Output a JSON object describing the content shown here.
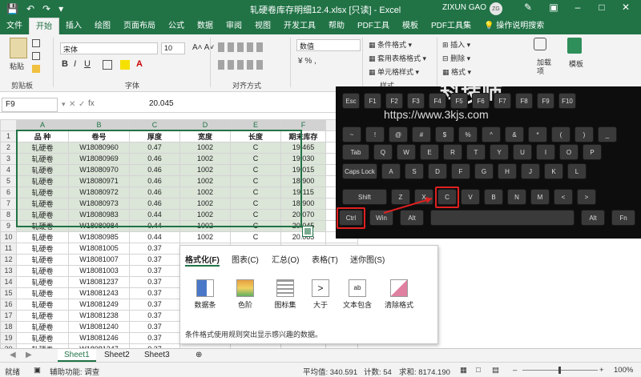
{
  "titlebar": {
    "title": "轧硬卷库存明细12.4.xlsx  [只读]  -  Excel",
    "user": "ZIXUN GAO",
    "avatar": "ZG",
    "qa_icons": [
      "save-icon",
      "undo-icon",
      "redo-icon",
      "customize-icon"
    ]
  },
  "menu": {
    "tabs": [
      "文件",
      "开始",
      "插入",
      "绘图",
      "页面布局",
      "公式",
      "数据",
      "审阅",
      "视图",
      "开发工具",
      "帮助",
      "PDF工具",
      "模板",
      "PDF工具集"
    ],
    "active": "开始",
    "tell_me": "操作说明搜索"
  },
  "ribbon": {
    "paste": "粘贴",
    "clipboard": "剪贴板",
    "font_name": "宋体",
    "font_size": "10",
    "font_group": "字体",
    "align_group": "对齐方式",
    "number_format": "数值",
    "cond_format": "条件格式",
    "table_format": "套用表格格式",
    "cell_styles": "单元格样式",
    "styles_group": "样式",
    "insert": "插入",
    "delete": "删除",
    "format": "格式",
    "addin": "加载项",
    "template": "模板"
  },
  "formula": {
    "cell_ref": "F9",
    "fx": "fx",
    "value": "20.045"
  },
  "sheet": {
    "columns": [
      "A",
      "B",
      "C",
      "D",
      "E",
      "F",
      "G"
    ],
    "rows": [
      [
        "1",
        "品  种",
        "卷号",
        "厚度",
        "宽度",
        "长度",
        "期末库存"
      ],
      [
        "2",
        "轧硬卷",
        "W18080960",
        "0.47",
        "1002",
        "C",
        "19.465"
      ],
      [
        "3",
        "轧硬卷",
        "W18080969",
        "0.46",
        "1002",
        "C",
        "19.030"
      ],
      [
        "4",
        "轧硬卷",
        "W18080970",
        "0.46",
        "1002",
        "C",
        "19.015"
      ],
      [
        "5",
        "轧硬卷",
        "W18080971",
        "0.46",
        "1002",
        "C",
        "18.900"
      ],
      [
        "6",
        "轧硬卷",
        "W18080972",
        "0.46",
        "1002",
        "C",
        "19.115"
      ],
      [
        "7",
        "轧硬卷",
        "W18080973",
        "0.46",
        "1002",
        "C",
        "18.900"
      ],
      [
        "8",
        "轧硬卷",
        "W18080983",
        "0.44",
        "1002",
        "C",
        "20.070"
      ],
      [
        "9",
        "轧硬卷",
        "W18080984",
        "0.44",
        "1002",
        "C",
        "20.045"
      ],
      [
        "10",
        "轧硬卷",
        "W18080985",
        "0.44",
        "1002",
        "C",
        "20.085"
      ],
      [
        "11",
        "轧硬卷",
        "W18081005",
        "0.37",
        "1002",
        "C",
        "17.630"
      ],
      [
        "12",
        "轧硬卷",
        "W18081007",
        "0.37",
        "",
        "",
        ""
      ],
      [
        "13",
        "轧硬卷",
        "W18081003",
        "0.37",
        "",
        "",
        ""
      ],
      [
        "14",
        "轧硬卷",
        "W18081237",
        "0.37",
        "",
        "",
        ""
      ],
      [
        "15",
        "轧硬卷",
        "W18081243",
        "0.37",
        "",
        "",
        ""
      ],
      [
        "16",
        "轧硬卷",
        "W18081249",
        "0.37",
        "",
        "",
        ""
      ],
      [
        "17",
        "轧硬卷",
        "W18081238",
        "0.37",
        "",
        "",
        ""
      ],
      [
        "18",
        "轧硬卷",
        "W18081240",
        "0.37",
        "",
        "",
        ""
      ],
      [
        "19",
        "轧硬卷",
        "W18081246",
        "0.37",
        "",
        "",
        ""
      ],
      [
        "20",
        "轧硬卷",
        "W18081247",
        "0.37",
        "",
        "",
        ""
      ],
      [
        "21",
        "轧硬卷",
        "W18081250",
        "0.37",
        "916",
        "C",
        "16.410"
      ]
    ]
  },
  "quick_analysis": {
    "tabs": [
      "格式化(F)",
      "图表(C)",
      "汇总(O)",
      "表格(T)",
      "迷你图(S)"
    ],
    "items": [
      "数据条",
      "色阶",
      "图标集",
      "大于",
      "文本包含",
      "清除格式"
    ],
    "description": "条件格式使用规则突出显示感兴趣的数据。"
  },
  "sheettabs": [
    "Sheet1",
    "Sheet2",
    "Sheet3"
  ],
  "status": {
    "ready": "就绪",
    "accessibility": "辅助功能: 调查",
    "average": "平均值: 340.591",
    "count": "计数: 54",
    "sum": "求和: 8174.190",
    "zoom": "100%"
  },
  "keyboard": {
    "watermark": "科技师",
    "url": "https://www.3kjs.com",
    "row1": [
      "Esc",
      "F1",
      "F2",
      "F3",
      "F4",
      "F5",
      "F6",
      "F7",
      "F8",
      "F9",
      "F10"
    ],
    "row2": [
      "~",
      "!",
      "@",
      "#",
      "$",
      "%",
      "^",
      "&",
      "*",
      "(",
      ")",
      "_"
    ],
    "row3": [
      "Tab",
      "Q",
      "W",
      "E",
      "R",
      "T",
      "Y",
      "U",
      "I",
      "O",
      "P"
    ],
    "row4": [
      "Caps Lock",
      "A",
      "S",
      "D",
      "F",
      "G",
      "H",
      "J",
      "K",
      "L"
    ],
    "row5": [
      "Shift",
      "Z",
      "X",
      "C",
      "V",
      "B",
      "N",
      "M",
      "<",
      ">"
    ],
    "row6": [
      "Ctrl",
      "Win",
      "Alt",
      "",
      "Alt",
      "Fn"
    ]
  },
  "colors": {
    "excel_green": "#217346",
    "highlight": "#dbe5d8",
    "red": "#e02020"
  }
}
